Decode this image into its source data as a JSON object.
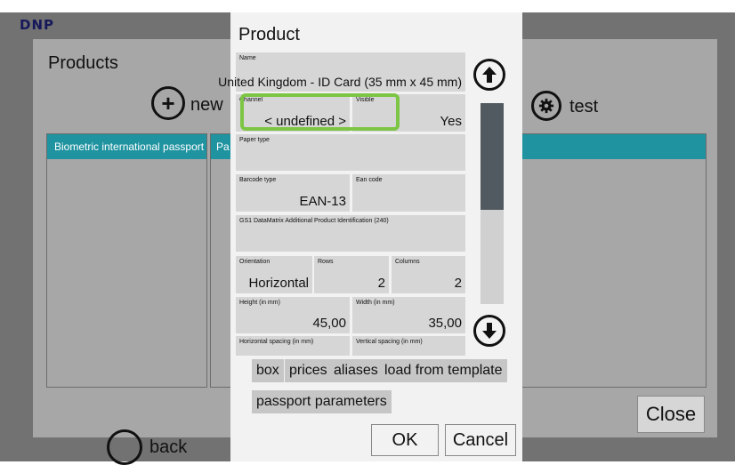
{
  "app": {
    "logo": "DNP",
    "panel_title": "Products",
    "new_label": "new",
    "test_label": "test",
    "list_items": [
      "Biometric international passport",
      "Pa"
    ],
    "close_label": "Close",
    "back_label": "back"
  },
  "dialog": {
    "title": "Product",
    "name_label": "Name",
    "name_value": "United Kingdom - ID Card (35 mm x 45 mm)",
    "channel_label": "Channel",
    "channel_value": "< undefined >",
    "visible_label": "Visible",
    "visible_value": "Yes",
    "paper_type_label": "Paper type",
    "paper_type_value": "",
    "barcode_type_label": "Barcode type",
    "barcode_type_value": "EAN-13",
    "ean_code_label": "Ean code",
    "ean_code_value": "",
    "gs1_label": "GS1 DataMatrix Additional Product Identification (240)",
    "gs1_value": "",
    "orientation_label": "Orientation",
    "orientation_value": "Horizontal",
    "rows_label": "Rows",
    "rows_value": "2",
    "columns_label": "Columns",
    "columns_value": "2",
    "height_label": "Height (in mm)",
    "height_value": "45,00",
    "width_label": "Width (in mm)",
    "width_value": "35,00",
    "hspacing_label": "Horizontal spacing (in mm)",
    "vspacing_label": "Vertical spacing (in mm)",
    "buttons": {
      "box": "box",
      "prices": "prices",
      "aliases": "aliases",
      "load_template": "load from template",
      "passport_parameters": "passport parameters",
      "ok": "OK",
      "cancel": "Cancel"
    }
  },
  "colors": {
    "accent": "#1f93a0",
    "highlight": "#7dc544",
    "background": "#727272"
  }
}
